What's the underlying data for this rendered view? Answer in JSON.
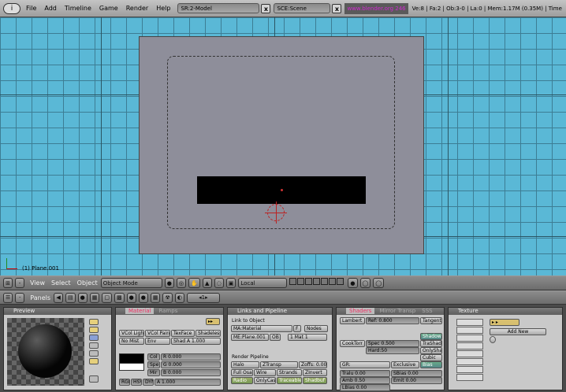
{
  "topbar": {
    "menus": [
      "File",
      "Add",
      "Timeline",
      "Game",
      "Render",
      "Help"
    ],
    "screen": "SR:2-Model",
    "scene": "SCE:Scene",
    "url": "www.blender.org 246",
    "stats": "Ve:8 | Fa:2 | Ob:3-0 | La:0 | Mem:1.17M (0.35M) | Time"
  },
  "viewport": {
    "object_label": "(1) Plane.001"
  },
  "view_header": {
    "view": "View",
    "select": "Select",
    "object": "Object",
    "mode": "Object Mode",
    "orientation": "Local"
  },
  "buttons_header": {
    "panels": "Panels",
    "frame": "1"
  },
  "preview": {
    "title": "Preview"
  },
  "material": {
    "tab_active": "Material",
    "tab_other": "Ramps",
    "row1": [
      "VCol Light",
      "VCol Paint",
      "TexFace",
      "Shadeless"
    ],
    "row2": [
      "No Mist",
      "Env",
      "Shad A 1.000"
    ],
    "col_labels": [
      "Col",
      "Spe",
      "Mir"
    ],
    "col_values": [
      "R 0.000",
      "G 0.000",
      "B 0.000",
      "A 1.000"
    ],
    "modes": [
      "RGB",
      "HSV",
      "DYN"
    ]
  },
  "links": {
    "title": "Links and Pipeline",
    "link_to_object": "Link to Object",
    "material": "MA:Material",
    "f": "F",
    "nodes": "Nodes",
    "me": "ME:Plane.001",
    "ob": "OB",
    "mat_index": "1 Mat 1",
    "render_pipeline": "Render Pipeline",
    "row1": [
      "Halo",
      "ZTransp",
      "Zoffs: 0.000"
    ],
    "row2": [
      "Full Osa",
      "Wire",
      "Strands",
      "ZInvert"
    ],
    "row3": [
      "Radio",
      "OnlyCast",
      "Traceable",
      "Shadbuf"
    ]
  },
  "shaders": {
    "tab_active": "Shaders",
    "tab_other": "Mirror Transp",
    "tab_sss": "SSS",
    "lambert": "Lambert",
    "ref": "Ref: 0.800",
    "tangent": "Tangent",
    "shadow": "Shadow",
    "cooktorr": "CookTorr",
    "spec": "Spec 0.500",
    "tra_shad": "TraShad",
    "hard": "Hard:50",
    "only_sha": "OnlySha",
    "cubic": "Cubic",
    "gr": "GR:",
    "exclusive": "Exclusive",
    "bias": "Bias",
    "tralu": "Tralu 0.00",
    "sbias": "SBias 0.00",
    "amb": "Amb 0.50",
    "emit": "Emit 0.00",
    "lbias": "LBias 0.00"
  },
  "texture": {
    "title": "Texture",
    "add_new": "Add New"
  }
}
